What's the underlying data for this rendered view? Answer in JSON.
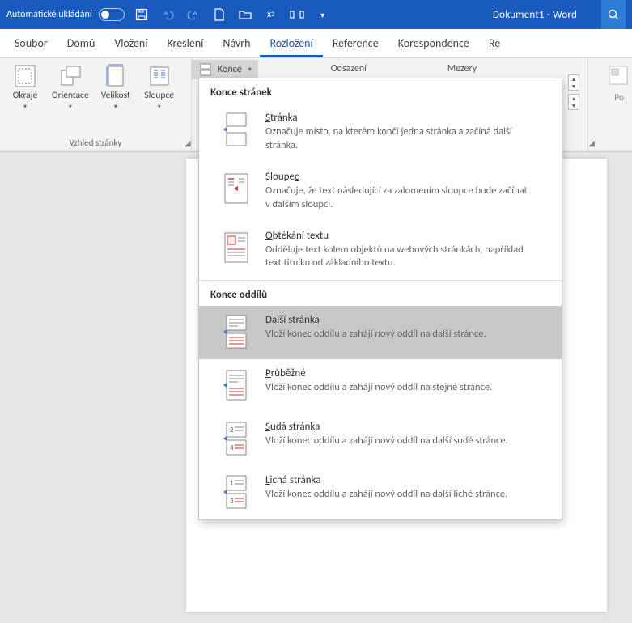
{
  "titlebar": {
    "autosave_label": "Automatické ukládání",
    "doc_title": "Dokument1 - Word"
  },
  "tabs": {
    "t0": "Soubor",
    "t1": "Domů",
    "t2": "Vložení",
    "t3": "Kreslení",
    "t4": "Návrh",
    "t5": "Rozložení",
    "t6": "Reference",
    "t7": "Korespondence",
    "t8": "Re"
  },
  "ribbon": {
    "page_setup": {
      "okraje": "Okraje",
      "orientace": "Orientace",
      "velikost": "Velikost",
      "sloupce": "Sloupce",
      "group_name": "Vzhled stránky",
      "konce": "Konce"
    },
    "indent": {
      "odsazeni": "Odsazení",
      "mezery": "Mezery"
    },
    "arrange": {
      "pozice": "Po"
    }
  },
  "dropdown": {
    "header1": "Konce stránek",
    "items1": {
      "i0": {
        "title_accel": "S",
        "title_rest": "tránka",
        "desc": "Označuje místo, na kterém končí jedna stránka a začíná další stránka."
      },
      "i1": {
        "title_accel": "S",
        "title_mid": "loupe",
        "title_accel2": "c",
        "title_rest": "",
        "desc": "Označuje, že text následující za zalomením sloupce bude začínat v dalším sloupci."
      },
      "i2": {
        "title_accel": "O",
        "title_rest": "btékání textu",
        "desc": "Odděluje text kolem objektů na webových stránkách, například text titulku od základního textu."
      }
    },
    "header2": "Konce oddílů",
    "items2": {
      "i0": {
        "title_accel": "D",
        "title_rest": "alší stránka",
        "desc": "Vloží konec oddílu a zahájí nový oddíl na další stránce."
      },
      "i1": {
        "title_accel": "P",
        "title_rest": "růběžné",
        "desc": "Vloží konec oddílu a zahájí nový oddíl na stejné stránce."
      },
      "i2": {
        "title_accel": "S",
        "title_rest": "udá stránka",
        "desc": "Vloží konec oddílu a zahájí nový oddíl na další sudé stránce."
      },
      "i3": {
        "title_accel": "L",
        "title_rest": "ichá stránka",
        "desc": "Vloží konec oddílu a zahájí nový oddíl na další liché stránce."
      }
    }
  }
}
